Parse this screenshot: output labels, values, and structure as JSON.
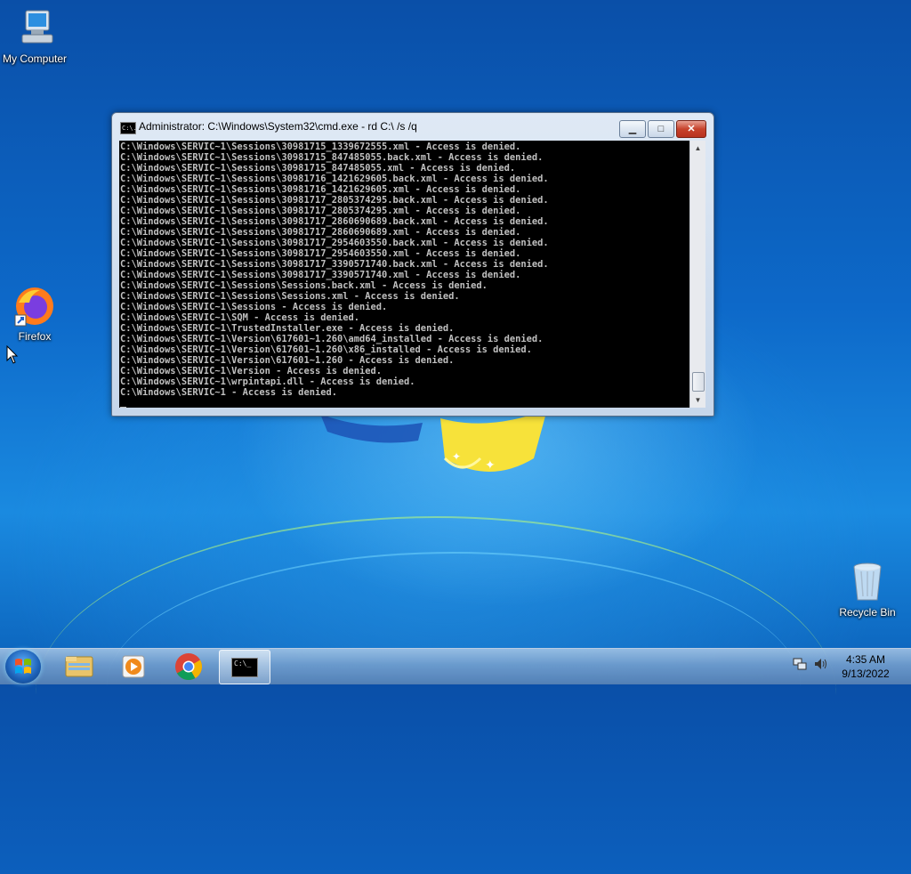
{
  "desktop": {
    "icons": [
      {
        "label": "My Computer",
        "icon": "computer-icon"
      },
      {
        "label": "Firefox",
        "icon": "firefox-icon"
      },
      {
        "label": "Recycle Bin",
        "icon": "recycle-bin-icon"
      }
    ]
  },
  "window": {
    "title": "Administrator: C:\\Windows\\System32\\cmd.exe - rd  C:\\ /s /q",
    "icon": "cmd-icon",
    "icon_text": "C:\\.",
    "buttons": {
      "minimize": "minimize-icon",
      "maximize": "maximize-icon",
      "close": "close-icon"
    },
    "console_lines": [
      "C:\\Windows\\SERVIC~1\\Sessions\\30981715_1339672555.xml - Access is denied.",
      "C:\\Windows\\SERVIC~1\\Sessions\\30981715_847485055.back.xml - Access is denied.",
      "C:\\Windows\\SERVIC~1\\Sessions\\30981715_847485055.xml - Access is denied.",
      "C:\\Windows\\SERVIC~1\\Sessions\\30981716_1421629605.back.xml - Access is denied.",
      "C:\\Windows\\SERVIC~1\\Sessions\\30981716_1421629605.xml - Access is denied.",
      "C:\\Windows\\SERVIC~1\\Sessions\\30981717_2805374295.back.xml - Access is denied.",
      "C:\\Windows\\SERVIC~1\\Sessions\\30981717_2805374295.xml - Access is denied.",
      "C:\\Windows\\SERVIC~1\\Sessions\\30981717_2860690689.back.xml - Access is denied.",
      "C:\\Windows\\SERVIC~1\\Sessions\\30981717_2860690689.xml - Access is denied.",
      "C:\\Windows\\SERVIC~1\\Sessions\\30981717_2954603550.back.xml - Access is denied.",
      "C:\\Windows\\SERVIC~1\\Sessions\\30981717_2954603550.xml - Access is denied.",
      "C:\\Windows\\SERVIC~1\\Sessions\\30981717_3390571740.back.xml - Access is denied.",
      "C:\\Windows\\SERVIC~1\\Sessions\\30981717_3390571740.xml - Access is denied.",
      "C:\\Windows\\SERVIC~1\\Sessions\\Sessions.back.xml - Access is denied.",
      "C:\\Windows\\SERVIC~1\\Sessions\\Sessions.xml - Access is denied.",
      "C:\\Windows\\SERVIC~1\\Sessions - Access is denied.",
      "C:\\Windows\\SERVIC~1\\SQM - Access is denied.",
      "C:\\Windows\\SERVIC~1\\TrustedInstaller.exe - Access is denied.",
      "C:\\Windows\\SERVIC~1\\Version\\617601~1.260\\amd64_installed - Access is denied.",
      "C:\\Windows\\SERVIC~1\\Version\\617601~1.260\\x86_installed - Access is denied.",
      "C:\\Windows\\SERVIC~1\\Version\\617601~1.260 - Access is denied.",
      "C:\\Windows\\SERVIC~1\\Version - Access is denied.",
      "C:\\Windows\\SERVIC~1\\wrpintapi.dll - Access is denied.",
      "C:\\Windows\\SERVIC~1 - Access is denied."
    ]
  },
  "taskbar": {
    "start": "windows-start-icon",
    "items": [
      {
        "name": "file-explorer-icon"
      },
      {
        "name": "media-player-icon"
      },
      {
        "name": "chrome-icon"
      },
      {
        "name": "cmd-icon",
        "active": true,
        "text": "C:\\_"
      }
    ],
    "tray": {
      "network": "network-icon",
      "volume": "volume-icon"
    },
    "clock": {
      "time": "4:35 AM",
      "date": "9/13/2022"
    }
  },
  "colors": {
    "console_bg": "#000000",
    "console_fg": "#c0c0c0",
    "close_button": "#c7432c"
  }
}
